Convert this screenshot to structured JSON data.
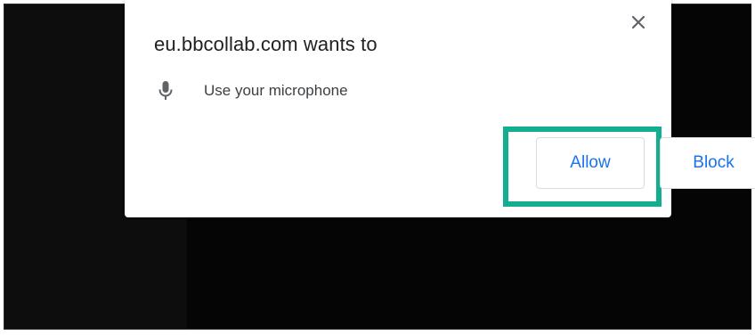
{
  "prompt": {
    "title": "eu.bbcollab.com wants to",
    "permission": {
      "icon": "microphone-icon",
      "label": "Use your microphone"
    },
    "buttons": {
      "allow_label": "Allow",
      "block_label": "Block"
    },
    "close_icon": "close-icon"
  },
  "colors": {
    "backdrop": "#0d0d0d",
    "button_text": "#1a73e8",
    "highlight": "#13ad8f"
  }
}
